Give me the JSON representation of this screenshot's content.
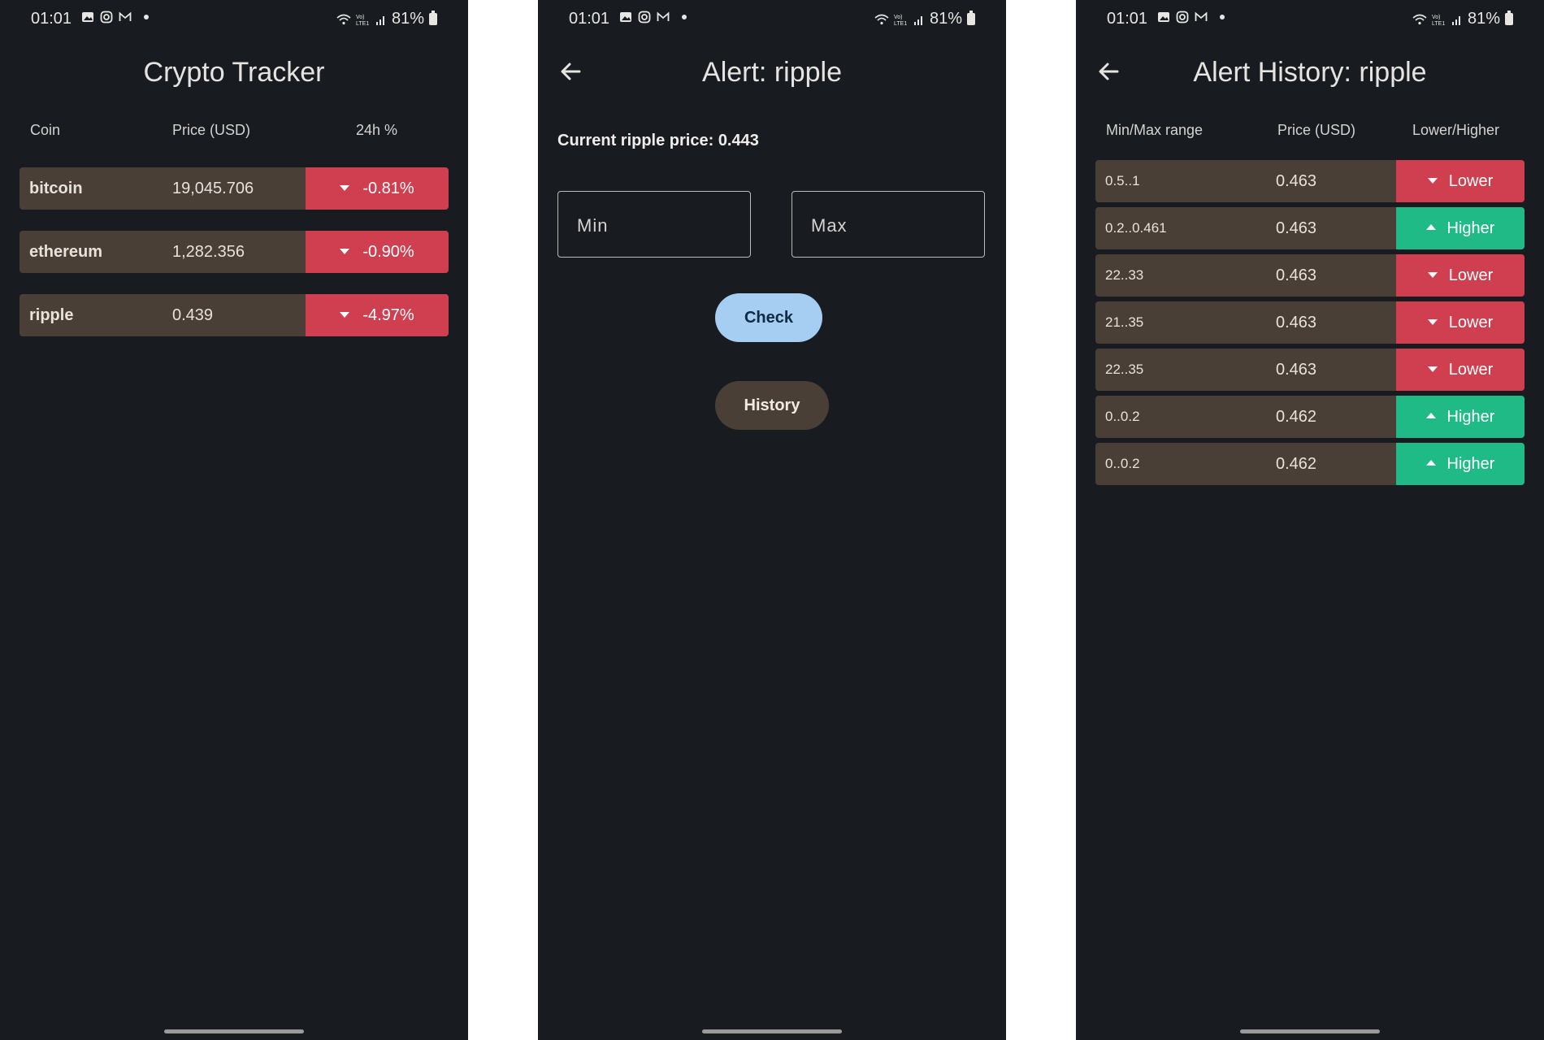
{
  "status_bar": {
    "time": "01:01",
    "battery": "81%",
    "network": "VoLTE"
  },
  "tracker": {
    "title": "Crypto Tracker",
    "headers": {
      "coin": "Coin",
      "price": "Price (USD)",
      "change": "24h %"
    },
    "rows": [
      {
        "coin": "bitcoin",
        "price": "19,045.706",
        "change": "-0.81%"
      },
      {
        "coin": "ethereum",
        "price": "1,282.356",
        "change": "-0.90%"
      },
      {
        "coin": "ripple",
        "price": "0.439",
        "change": "-4.97%"
      }
    ]
  },
  "alert": {
    "title": "Alert: ripple",
    "current_price": "Current ripple price: 0.443",
    "min_placeholder": "Min",
    "max_placeholder": "Max",
    "check_label": "Check",
    "history_label": "History"
  },
  "history": {
    "title": "Alert History: ripple",
    "headers": {
      "range": "Min/Max range",
      "price": "Price (USD)",
      "direction": "Lower/Higher"
    },
    "rows": [
      {
        "range": "0.5..1",
        "price": "0.463",
        "direction": "Lower"
      },
      {
        "range": "0.2..0.461",
        "price": "0.463",
        "direction": "Higher"
      },
      {
        "range": "22..33",
        "price": "0.463",
        "direction": "Lower"
      },
      {
        "range": "21..35",
        "price": "0.463",
        "direction": "Lower"
      },
      {
        "range": "22..35",
        "price": "0.463",
        "direction": "Lower"
      },
      {
        "range": "0..0.2",
        "price": "0.462",
        "direction": "Higher"
      },
      {
        "range": "0..0.2",
        "price": "0.462",
        "direction": "Higher"
      }
    ]
  },
  "colors": {
    "background": "#181c20",
    "row": "#4a3f36",
    "negative": "#d03f4f",
    "positive": "#1fba85",
    "check_button": "#a6cdf2"
  }
}
